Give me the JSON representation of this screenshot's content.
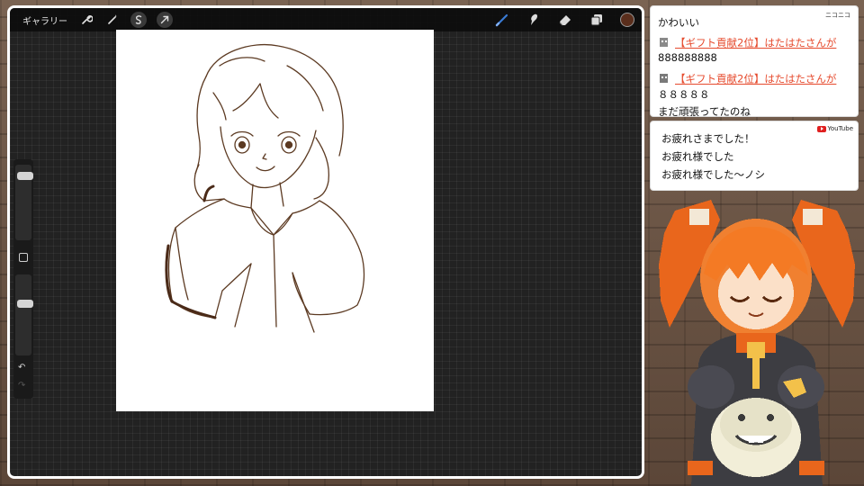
{
  "app": {
    "gallery_label": "ギャラリー",
    "left_tools": [
      "wrench-icon",
      "magic-wand-icon",
      "selection-icon",
      "transform-arrow-icon"
    ],
    "right_tools": [
      "brush-icon",
      "smudge-icon",
      "eraser-icon",
      "layers-icon"
    ],
    "current_color": "#5a2e1c",
    "accent_color": "#3a7bd5",
    "sidebar_icons": {
      "undo": "↶",
      "redo": "↷"
    }
  },
  "niconico_chat": {
    "brand": "ニコニコ",
    "messages": [
      {
        "type": "text",
        "text": "かわいい"
      },
      {
        "type": "gift",
        "text": "【ギフト貢献2位】はたはたさんが"
      },
      {
        "type": "text",
        "text": "888888888"
      },
      {
        "type": "gift",
        "text": "【ギフト貢献2位】はたはたさんが"
      },
      {
        "type": "text",
        "text": "８８８８８"
      },
      {
        "type": "text",
        "text": "まだ頑張ってたのね"
      }
    ]
  },
  "youtube_chat": {
    "brand": "YouTube",
    "messages": [
      "お疲れさまでした！",
      "お疲れ様でした",
      "お疲れ様でした〜ノシ"
    ]
  }
}
